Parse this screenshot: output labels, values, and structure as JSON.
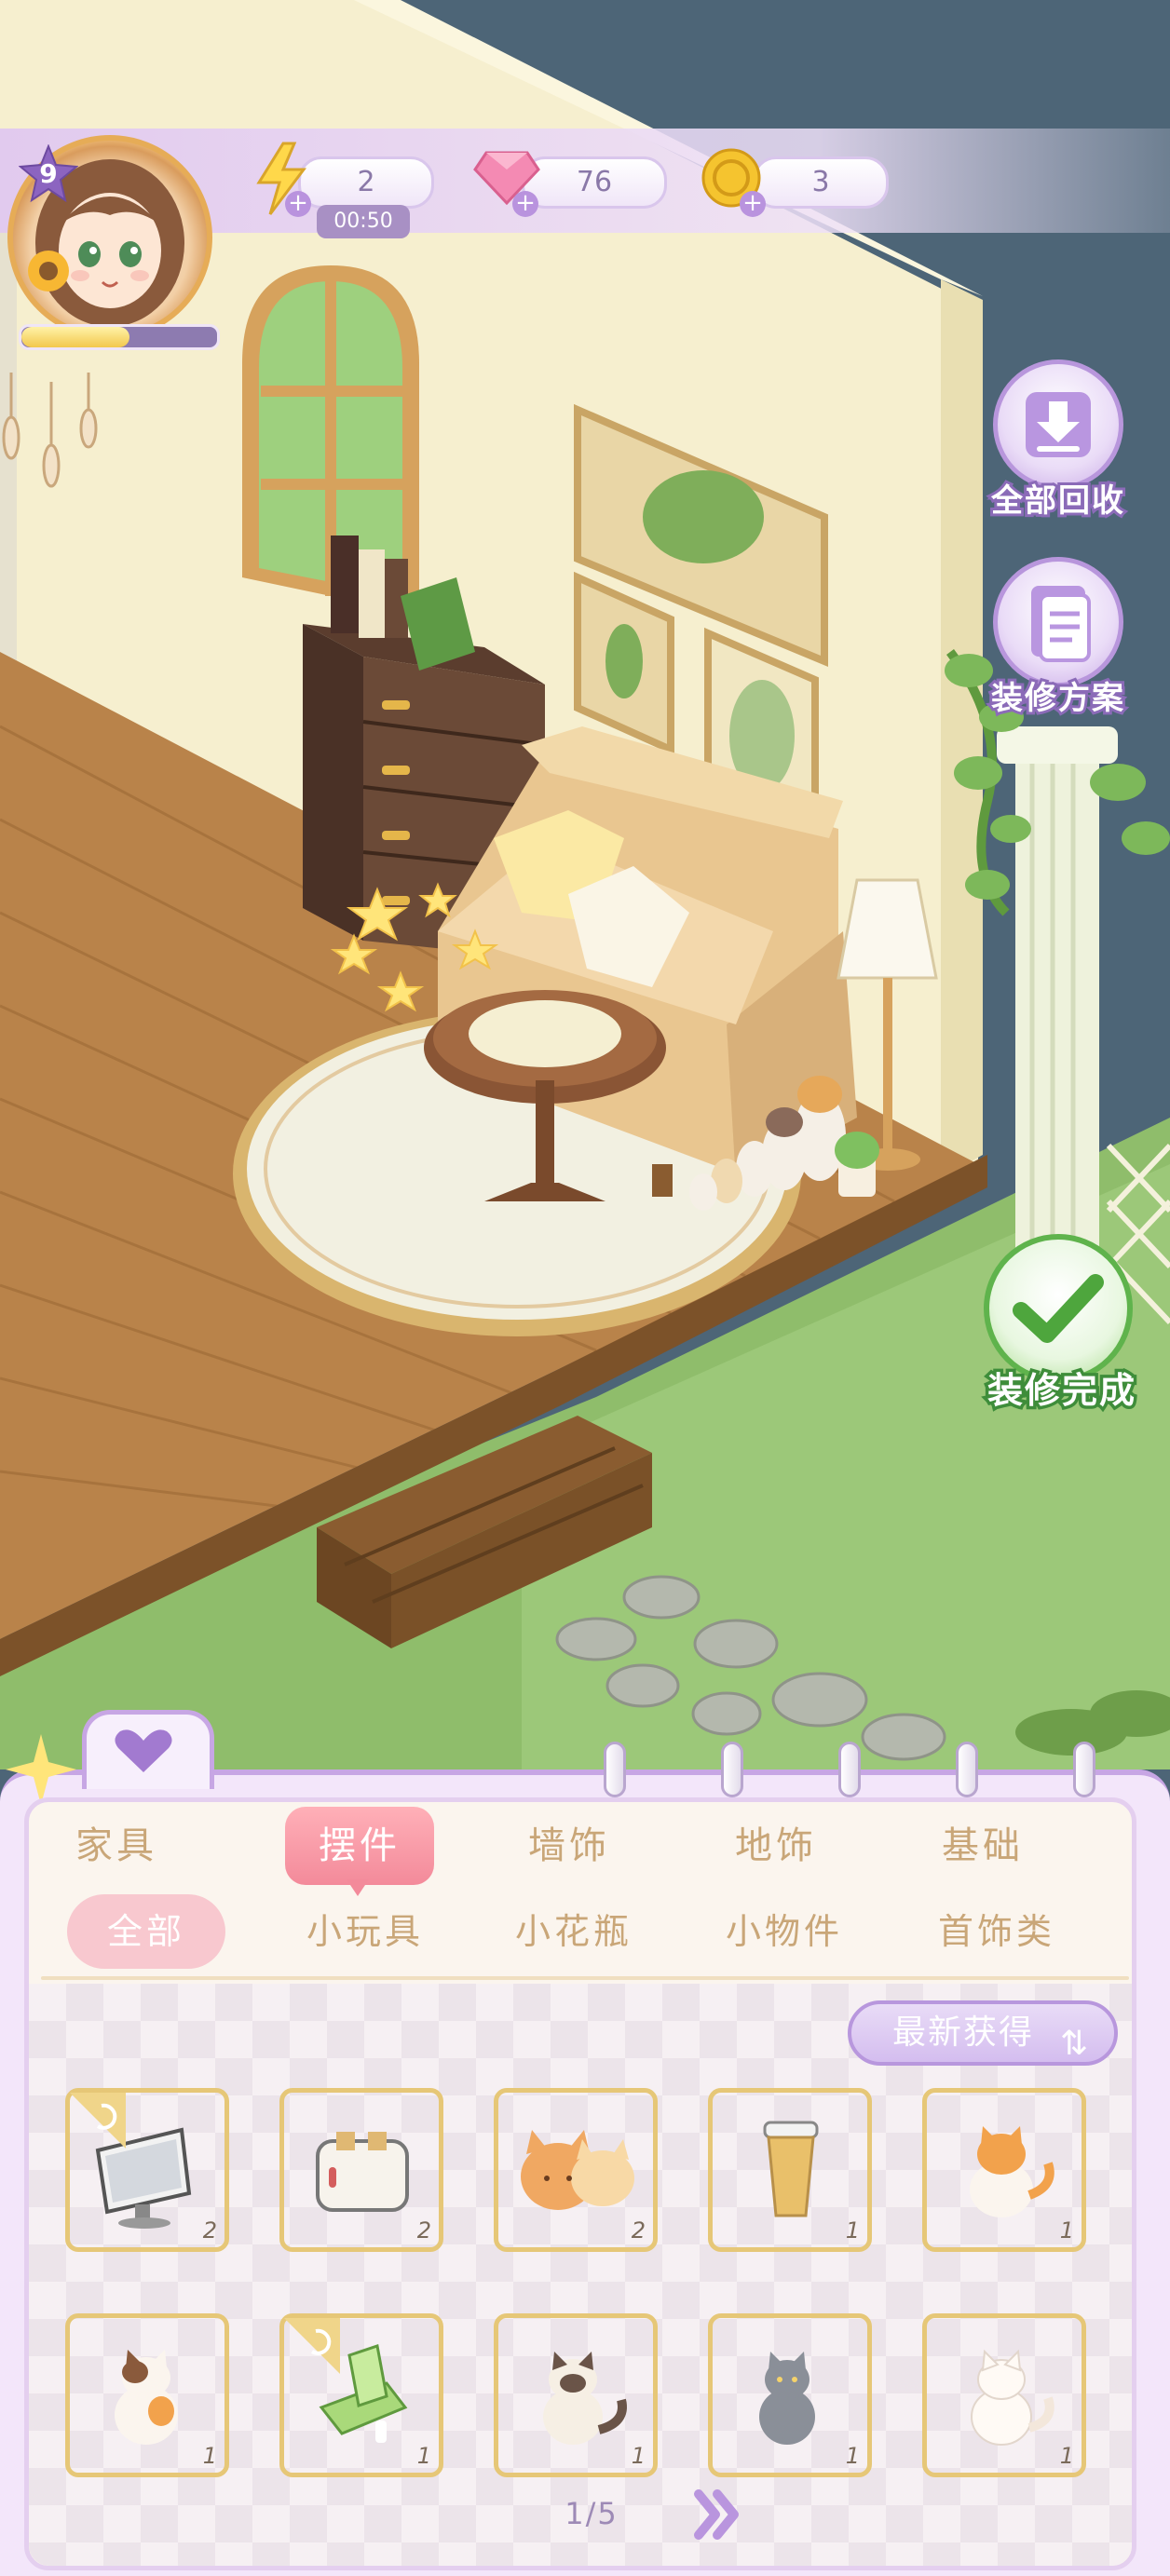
{
  "player": {
    "level": "9",
    "xp_fraction": 0.55
  },
  "resources": {
    "energy": {
      "icon": "lightning-icon",
      "value": "2",
      "timer": "00:50"
    },
    "gems": {
      "icon": "gem-icon",
      "value": "76"
    },
    "coins": {
      "icon": "coin-icon",
      "value": "3"
    }
  },
  "side_buttons": {
    "recycle_all": "全部回收",
    "decor_plan": "装修方案",
    "finish": "装修完成"
  },
  "main_tabs": [
    {
      "label": "家具",
      "active": false
    },
    {
      "label": "摆件",
      "active": true
    },
    {
      "label": "墙饰",
      "active": false
    },
    {
      "label": "地饰",
      "active": false
    },
    {
      "label": "基础",
      "active": false
    }
  ],
  "sub_tabs": [
    {
      "label": "全部",
      "active": true
    },
    {
      "label": "小玩具",
      "active": false
    },
    {
      "label": "小花瓶",
      "active": false
    },
    {
      "label": "小物件",
      "active": false
    },
    {
      "label": "首饰类",
      "active": false
    }
  ],
  "sort_button": "最新获得",
  "items": [
    {
      "name": "monitor",
      "count": "2",
      "bg": "blue",
      "corner": true
    },
    {
      "name": "toaster",
      "count": "2",
      "bg": "blue",
      "corner": false
    },
    {
      "name": "cat-cushions",
      "count": "2",
      "bg": "blue",
      "corner": false
    },
    {
      "name": "cup",
      "count": "1",
      "bg": "pink",
      "corner": false
    },
    {
      "name": "orange-cat",
      "count": "1",
      "bg": "pink",
      "corner": false
    },
    {
      "name": "calico-cat",
      "count": "1",
      "bg": "pink",
      "corner": false
    },
    {
      "name": "green-gadget",
      "count": "1",
      "bg": "pink",
      "corner": true
    },
    {
      "name": "siamese-cat",
      "count": "1",
      "bg": "pink",
      "corner": false
    },
    {
      "name": "gray-cat",
      "count": "1",
      "bg": "pink",
      "corner": false
    },
    {
      "name": "white-cat",
      "count": "1",
      "bg": "pink",
      "corner": false
    }
  ],
  "pagination": "1/5"
}
